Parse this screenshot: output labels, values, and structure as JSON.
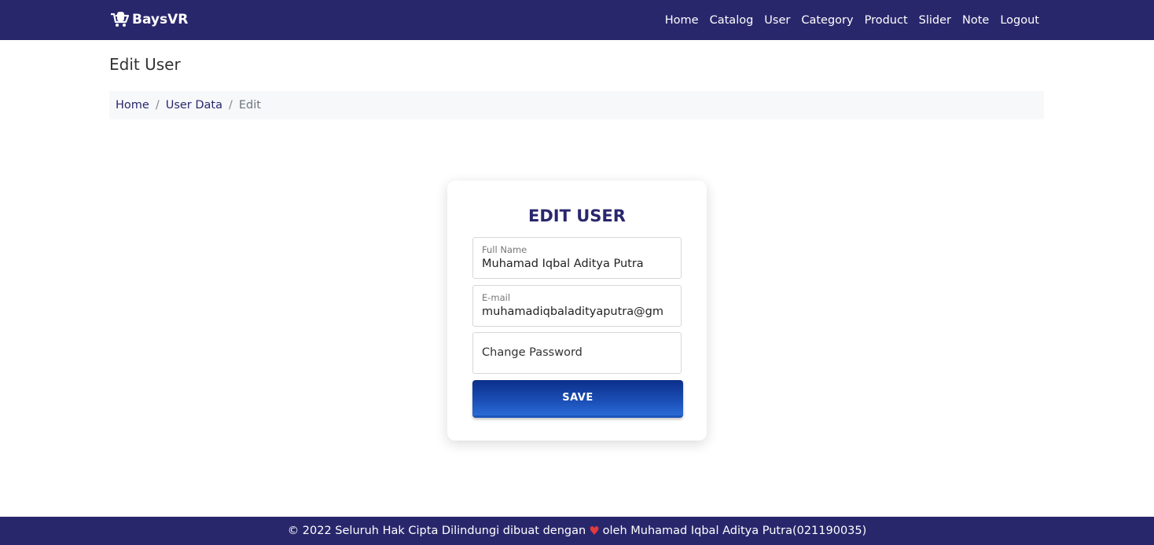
{
  "brand": {
    "name": "BaysVR",
    "logo_icon": "cart-logo-icon"
  },
  "nav": {
    "links": [
      "Home",
      "Catalog",
      "User",
      "Category",
      "Product",
      "Slider",
      "Note",
      "Logout"
    ]
  },
  "page": {
    "title": "Edit User"
  },
  "breadcrumb": {
    "items": [
      "Home",
      "User Data"
    ],
    "separator": "/",
    "active": "Edit"
  },
  "form": {
    "title": "EDIT USER",
    "full_name": {
      "label": "Full Name",
      "value": "Muhamad Iqbal Aditya Putra"
    },
    "email": {
      "label": "E-mail",
      "value": "muhamadiqbaladityaputra@gm"
    },
    "password": {
      "placeholder": "Change Password"
    },
    "save_label": "SAVE"
  },
  "footer": {
    "text_before": "© 2022 Seluruh Hak Cipta Dilindungi dibuat dengan",
    "heart": "♥",
    "text_after": "oleh Muhamad Iqbal Aditya Putra(021190035)"
  },
  "colors": {
    "primary": "#29276c",
    "button": "#1b4fb7",
    "heart": "#e23b3b"
  }
}
